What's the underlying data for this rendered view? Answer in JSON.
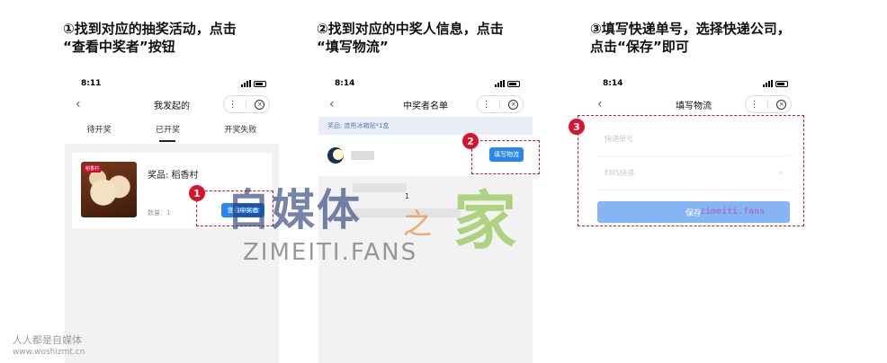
{
  "steps": [
    {
      "badge": "1",
      "title_line1": "①找到对应的抽奖活动，点击",
      "title_line2": "“查看中奖者”按钮"
    },
    {
      "badge": "2",
      "title_line1": "②找到对应的中奖人信息，点击",
      "title_line2": "“填写物流”"
    },
    {
      "badge": "3",
      "title_line1": "③填写快递单号，选择快递公司，",
      "title_line2": "点击“保存”即可"
    }
  ],
  "phone1": {
    "time": "8:11",
    "nav_title": "我发起的",
    "tabs": [
      "待开奖",
      "已开奖",
      "开奖失败"
    ],
    "active_tab": 1,
    "brand": "稻香村",
    "prize_label": "奖品: 稻香村",
    "quantity": "数量：1",
    "button": "查看中奖者"
  },
  "phone2": {
    "time": "8:14",
    "nav_title": "中奖者名单",
    "prize_strip": "奖品: 度熊冰箱贴*1盒",
    "button": "填写物流",
    "count": "1"
  },
  "phone3": {
    "time": "8:14",
    "nav_title": "填写物流",
    "tracking_placeholder": "快递单号",
    "courier": "EMS快递",
    "save": "保存"
  },
  "nav": {
    "more": "⋮",
    "close": "×",
    "back": "‹"
  },
  "watermark": {
    "cn": "自媒体",
    "jia": "家",
    "swirl": "之",
    "en": "ZIMEITI.FANS",
    "small": "zimeiti.fans",
    "corner_l1": "人人都是自媒体",
    "corner_l2": "www.woshizmt.cn"
  },
  "colors": {
    "accent": "#2a86e8",
    "highlight": "#d9122e"
  }
}
